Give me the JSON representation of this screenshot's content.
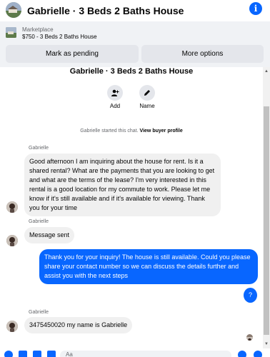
{
  "header": {
    "title": "Gabrielle · 3 Beds 2 Baths House",
    "info_icon": "info-icon"
  },
  "listing": {
    "source": "Marketplace",
    "price_title": "$750 - 3 Beds 2 Baths House",
    "mark_pending_label": "Mark as pending",
    "more_options_label": "More options"
  },
  "chat": {
    "title": "Gabrielle · 3 Beds 2 Baths House",
    "actions": [
      {
        "label": "Add",
        "icon": "add-person-icon"
      },
      {
        "label": "Name",
        "icon": "pencil-icon"
      }
    ],
    "started_text": "Gabrielle started this chat.",
    "view_profile_label": "View buyer profile",
    "messages": [
      {
        "sender": "Gabrielle",
        "direction": "incoming",
        "text": "Good afternoon I am inquiring about the house for rent. Is it a shared rental? What are the payments that you are looking to get and what are the terms of the lease? I'm very interested in this rental is a good location for my commute to work. Please let me know if it's still available and if it's available for viewing. Thank you for your time"
      },
      {
        "sender": "Gabrielle",
        "direction": "incoming",
        "text": "Message sent"
      },
      {
        "direction": "outgoing",
        "text": "Thank you for your inquiry! The house is still available. Could you please share your contact number so we can discuss the details further and assist you with the next steps"
      },
      {
        "direction": "outgoing",
        "text": "?"
      },
      {
        "sender": "Gabrielle",
        "direction": "incoming",
        "text": "3475450020 my name is Gabrielle"
      }
    ]
  },
  "composer": {
    "placeholder": "Aa"
  },
  "colors": {
    "accent": "#0866ff",
    "bubble_in": "#f0f0f0",
    "panel": "#f0f2f5",
    "button": "#e4e6eb"
  }
}
